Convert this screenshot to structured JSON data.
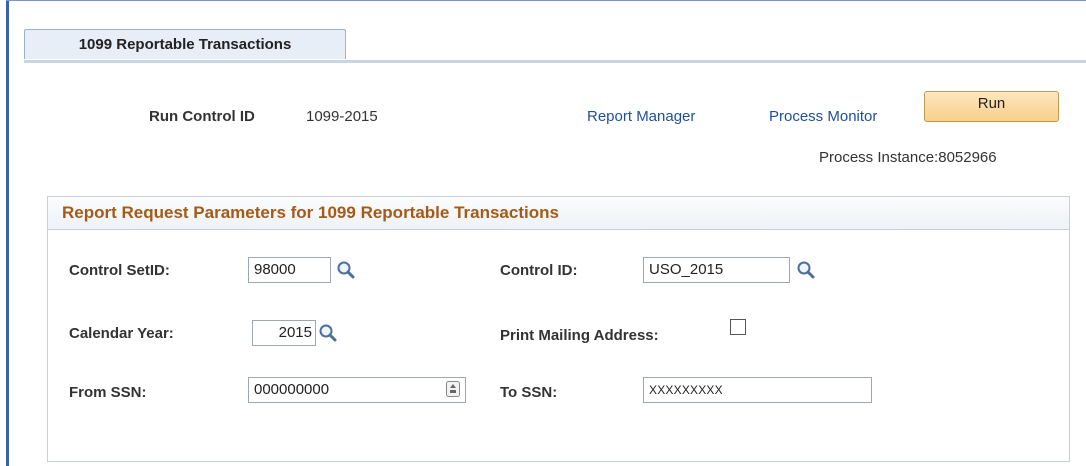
{
  "tab": {
    "label": "1099 Reportable Transactions"
  },
  "header": {
    "run_control_label": "Run Control ID",
    "run_control_value": "1099-2015",
    "report_manager_link": "Report Manager",
    "process_monitor_link": "Process Monitor",
    "run_button": "Run",
    "process_instance": "Process Instance:8052966"
  },
  "params": {
    "title": "Report Request Parameters for 1099 Reportable Transactions",
    "control_setid": {
      "label": "Control SetID:",
      "value": "98000"
    },
    "control_id": {
      "label": "Control ID:",
      "value": "USO_2015"
    },
    "calendar_year": {
      "label": "Calendar Year:",
      "value": "2015"
    },
    "print_mailing": {
      "label": "Print Mailing Address:",
      "checked": false
    },
    "from_ssn": {
      "label": "From SSN:",
      "value": "000000000"
    },
    "to_ssn": {
      "label": "To SSN:",
      "value": "XXXXXXXXX"
    }
  },
  "icons": {
    "lookup": "magnifier-icon",
    "spin": "spin-icon"
  }
}
